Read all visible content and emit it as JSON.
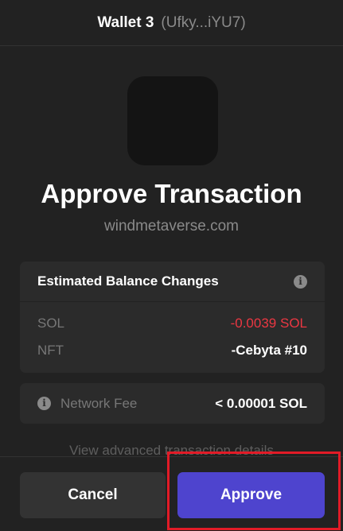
{
  "header": {
    "wallet_name": "Wallet 3",
    "wallet_address": "(Ufky...iYU7)"
  },
  "app": {
    "icon": "app-logo-icon",
    "title": "Approve Transaction",
    "origin": "windmetaverse.com"
  },
  "balance_changes": {
    "heading": "Estimated Balance Changes",
    "info_icon": "info-icon",
    "rows": [
      {
        "label": "SOL",
        "value": "-0.0039 SOL",
        "status": "negative"
      },
      {
        "label": "NFT",
        "value": "-Cebyta #10",
        "status": "neutral"
      }
    ]
  },
  "network_fee": {
    "label": "Network Fee",
    "value": "< 0.00001 SOL",
    "info_icon": "info-icon"
  },
  "advanced_link": "View advanced transaction details",
  "footer": {
    "cancel_label": "Cancel",
    "approve_label": "Approve"
  },
  "colors": {
    "background": "#222222",
    "card": "#2b2b2b",
    "accent": "#4e44ce",
    "negative": "#eb3742",
    "highlight": "#e21b27"
  }
}
